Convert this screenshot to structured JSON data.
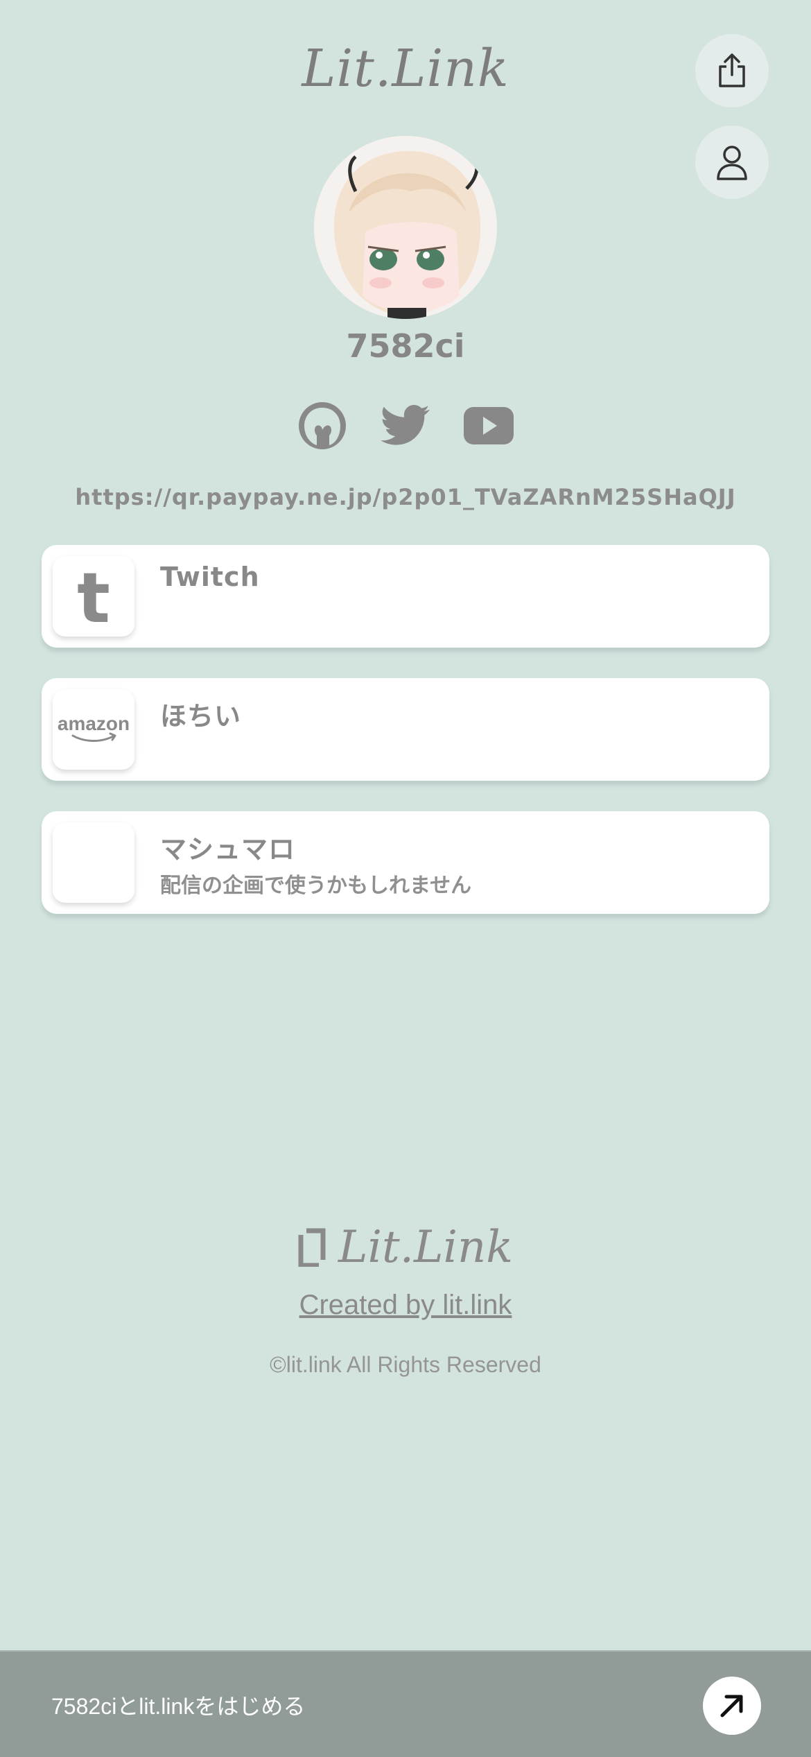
{
  "header": {
    "logo_text": "Lit.Link",
    "share_icon": "share-icon",
    "profile_icon": "user-icon"
  },
  "profile": {
    "username": "7582ci",
    "avatar_icon": "avatar-image",
    "social_icons": [
      "cluster-icon",
      "twitter-icon",
      "youtube-icon"
    ],
    "url_text": "https://qr.paypay.ne.jp/p2p01_TVaZARnM25SHaQJJ"
  },
  "links": [
    {
      "title": "Twitch",
      "description": "",
      "icon": "twitch-icon"
    },
    {
      "title": "ほちい",
      "description": "",
      "icon": "amazon-icon",
      "icon_text": "amazon"
    },
    {
      "title": "マシュマロ",
      "description": "配信の企画で使うかもしれません",
      "icon": "blank-thumbnail"
    }
  ],
  "footer": {
    "logo_text": "Lit.Link",
    "created_link": "Created by lit.link",
    "copyright": "©lit.link All Rights Reserved"
  },
  "banner": {
    "text": "7582ciとlit.linkをはじめる",
    "button_icon": "arrow-up-right-icon"
  },
  "colors": {
    "background": "#d3e3de",
    "banner": "#919c98",
    "text": "#8a8a8a"
  }
}
